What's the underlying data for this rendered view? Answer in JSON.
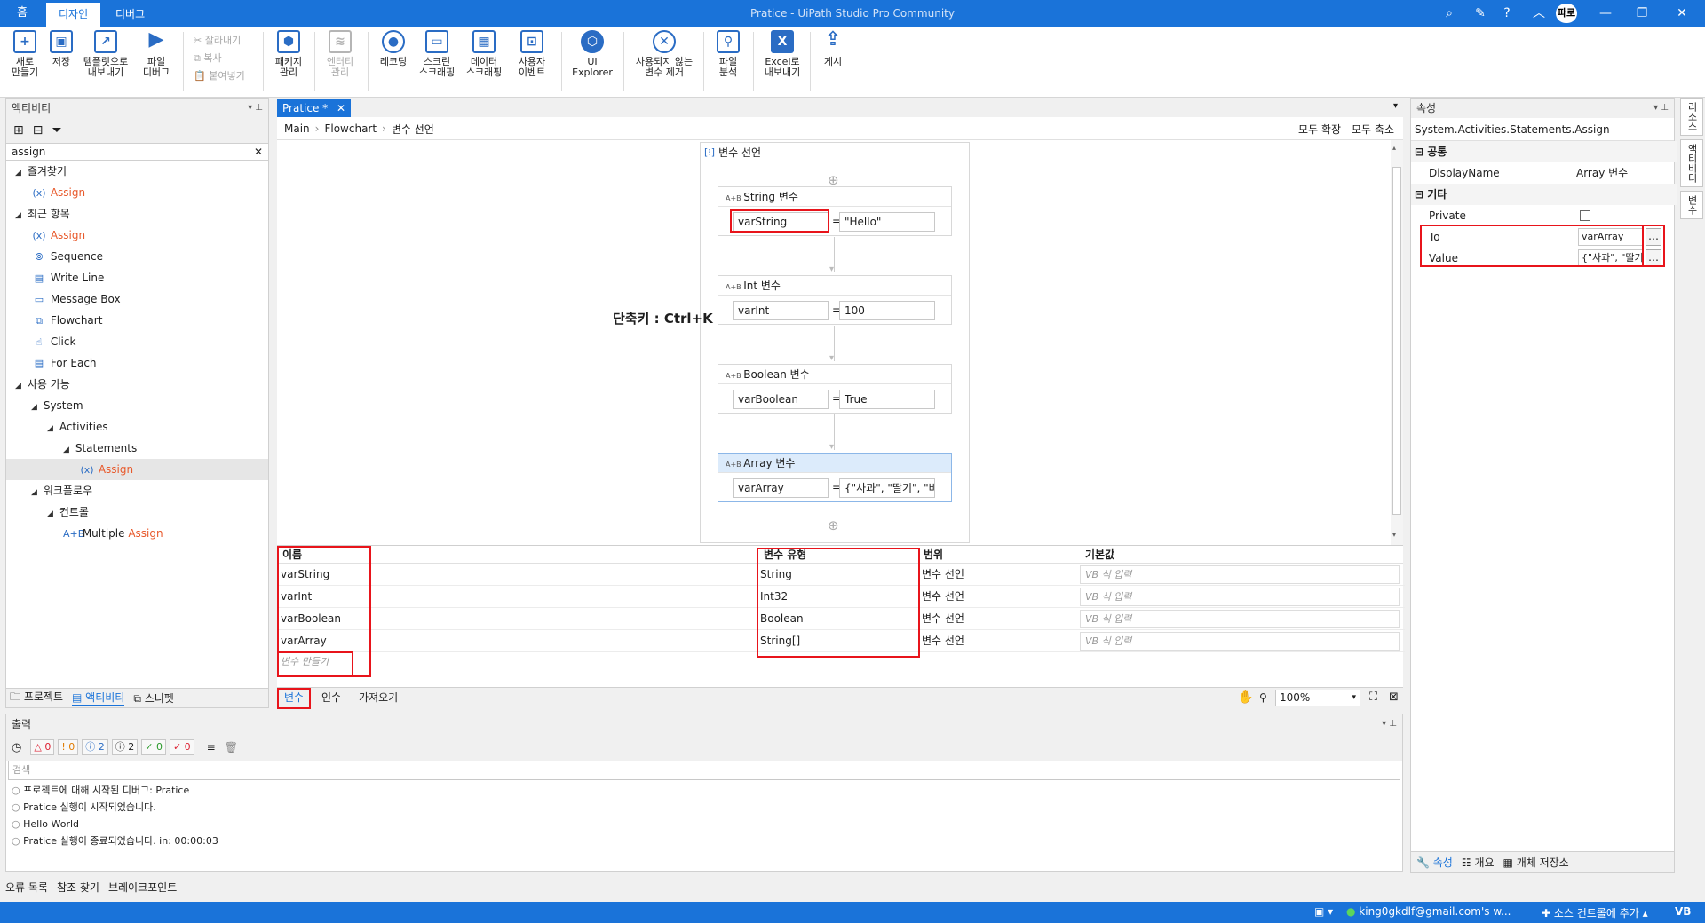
{
  "title_bar": {
    "home_label": "홈",
    "tabs": [
      "디자인",
      "디버그"
    ],
    "title": "Pratice - UiPath Studio Pro Community",
    "user_initials": "파로"
  },
  "ribbon": {
    "new": "새로\n만들기",
    "save": "저장",
    "export_template": "템플릿으로\n내보내기",
    "debug_file": "파일\n디버그",
    "cut": "잘라내기",
    "copy": "복사",
    "paste": "붙여넣기",
    "manage_packages": "패키지\n관리",
    "manage_entities": "엔터티\n관리",
    "recording": "레코딩",
    "screen_scraping": "스크린\n스크래핑",
    "data_scraping": "데이터\n스크래핑",
    "user_events": "사용자\n이벤트",
    "ui_explorer": "UI\nExplorer",
    "remove_unused": "사용되지 않는\n변수 제거",
    "analyze_file": "파일\n분석",
    "export_excel": "Excel로\n내보내기",
    "publish": "게시"
  },
  "activities_panel": {
    "title": "액티비티",
    "search_value": "assign",
    "tree": [
      {
        "label": "즐겨찾기",
        "level": 0,
        "toggle": "◢"
      },
      {
        "label": "Assign",
        "level": 1,
        "icon": "(x)",
        "orange": true
      },
      {
        "label": "최근 항목",
        "level": 0,
        "toggle": "◢"
      },
      {
        "label": "Assign",
        "level": 1,
        "icon": "(x)",
        "orange": true
      },
      {
        "label": "Sequence",
        "level": 1,
        "icon": "⦾"
      },
      {
        "label": "Write Line",
        "level": 1,
        "icon": "▤"
      },
      {
        "label": "Message Box",
        "level": 1,
        "icon": "▭"
      },
      {
        "label": "Flowchart",
        "level": 1,
        "icon": "⧉"
      },
      {
        "label": "Click",
        "level": 1,
        "icon": "☝"
      },
      {
        "label": "For Each",
        "level": 1,
        "icon": "▤"
      },
      {
        "label": "사용 가능",
        "level": 0,
        "toggle": "◢"
      },
      {
        "label": "System",
        "level": 1,
        "toggle": "◢"
      },
      {
        "label": "Activities",
        "level": 2,
        "toggle": "◢"
      },
      {
        "label": "Statements",
        "level": 3,
        "toggle": "◢"
      },
      {
        "label": "Assign",
        "level": 4,
        "icon": "(x)",
        "orange": true,
        "selected": true
      },
      {
        "label": "워크플로우",
        "level": 1,
        "toggle": "◢"
      },
      {
        "label": "컨트롤",
        "level": 2,
        "toggle": "◢"
      },
      {
        "label": "Multiple Assign",
        "level": 3,
        "icon": "A+B",
        "prefix": "Multiple ",
        "suffix": "Assign"
      }
    ],
    "bottom_tabs": [
      "프로젝트",
      "액티비티",
      "스니펫"
    ]
  },
  "designer": {
    "doc_tab": "Pratice *",
    "breadcrumb": [
      "Main",
      "Flowchart",
      "변수 선언"
    ],
    "expand_all": "모두 확장",
    "collapse_all": "모두 축소",
    "sequence_title": "변수 선언",
    "shortcut_note": "단축키 : Ctrl+K",
    "assigns": [
      {
        "title": "String 변수",
        "to": "varString",
        "value": "\"Hello\""
      },
      {
        "title": "Int 변수",
        "to": "varInt",
        "value": "100"
      },
      {
        "title": "Boolean 변수",
        "to": "varBoolean",
        "value": "True"
      },
      {
        "title": "Array 변수",
        "to": "varArray",
        "value": "{\"사과\", \"딸기\", \"바"
      }
    ]
  },
  "variables": {
    "headers": [
      "이름",
      "변수 유형",
      "범위",
      "기본값"
    ],
    "rows": [
      {
        "name": "varString",
        "type": "String",
        "scope": "변수 선언",
        "default": "VB 식 입력"
      },
      {
        "name": "varInt",
        "type": "Int32",
        "scope": "변수 선언",
        "default": "VB 식 입력"
      },
      {
        "name": "varBoolean",
        "type": "Boolean",
        "scope": "변수 선언",
        "default": "VB 식 입력"
      },
      {
        "name": "varArray",
        "type": "String[]",
        "scope": "변수 선언",
        "default": "VB 식 입력"
      }
    ],
    "create_placeholder": "변수 만들기",
    "tabs": [
      "변수",
      "인수",
      "가져오기"
    ],
    "zoom": "100%"
  },
  "output": {
    "title": "출력",
    "counts": [
      "0",
      "0",
      "2",
      "2",
      "0",
      "0"
    ],
    "search_placeholder": "검색",
    "lines": [
      "프로젝트에 대해 시작된 디버그: Pratice",
      "Pratice 실행이 시작되었습니다.",
      "Hello World",
      "Pratice 실행이 종료되었습니다. in: 00:00:03"
    ],
    "bottom_tabs": [
      "오류 목록",
      "참조 찾기",
      "브레이크포인트"
    ]
  },
  "properties": {
    "title": "속성",
    "class_name": "System.Activities.Statements.Assign",
    "section_common": "공통",
    "display_name_label": "DisplayName",
    "display_name_value": "Array 변수",
    "section_misc": "기타",
    "private_label": "Private",
    "to_label": "To",
    "to_value": "varArray",
    "value_label": "Value",
    "value_value": "{\"사과\", \"딸기\",",
    "bottom_tabs": [
      "속성",
      "개요",
      "개체 저장소"
    ]
  },
  "right_rail": [
    "리소스",
    "액티비티",
    "변수"
  ],
  "status_bar": {
    "user": "king0gkdlf@gmail.com's w...",
    "source_control": "소스 컨트롤에 추가",
    "lang": "VB"
  },
  "colors": {
    "accent": "#1a73d9",
    "highlight_red": "#e8141b",
    "activity_orange": "#e8592b"
  }
}
